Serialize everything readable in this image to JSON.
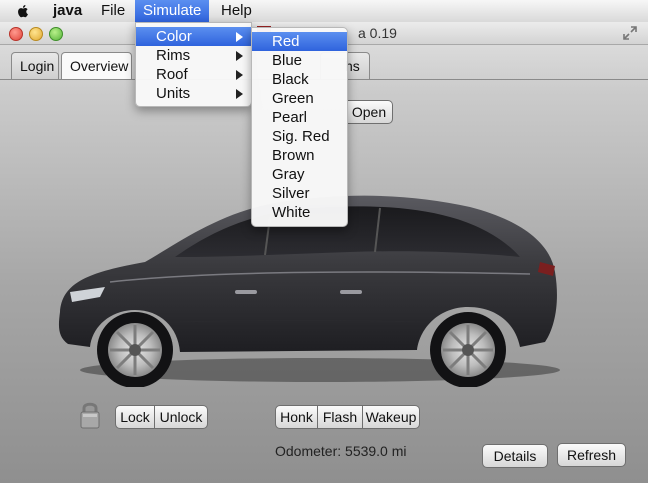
{
  "menubar": {
    "app": "java",
    "items": [
      "File",
      "Simulate",
      "Help"
    ]
  },
  "window": {
    "title": "a 0.19"
  },
  "tabs": [
    "Login",
    "Overview",
    "hs"
  ],
  "hidden_controls": {
    "open_button": "Open"
  },
  "simulate_menu": {
    "items": [
      {
        "label": "Color",
        "submenu": true
      },
      {
        "label": "Rims",
        "submenu": true
      },
      {
        "label": "Roof",
        "submenu": true
      },
      {
        "label": "Units",
        "submenu": true
      }
    ]
  },
  "color_submenu": {
    "items": [
      "Red",
      "Blue",
      "Black",
      "Green",
      "Pearl",
      "Sig. Red",
      "Brown",
      "Gray",
      "Silver",
      "White"
    ],
    "selected": "Red"
  },
  "controls": {
    "lock": "Lock",
    "unlock": "Unlock",
    "honk": "Honk",
    "flash": "Flash",
    "wakeup": "Wakeup",
    "details": "Details",
    "refresh": "Refresh"
  },
  "odometer": "Odometer: 5539.0 mi",
  "icons": {
    "apple": "apple-icon",
    "lock": "padlock-icon",
    "fullscreen": "fullscreen-icon",
    "submenu_arrow": "chevron-right-icon"
  },
  "colors": {
    "menu_highlight": "#3a6ee6",
    "car_body": "#3a3a3e"
  }
}
